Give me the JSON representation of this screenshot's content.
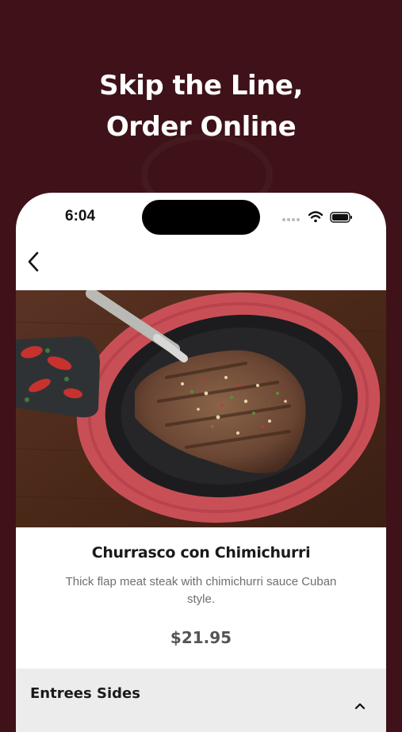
{
  "promo": {
    "headline_line1": "Skip the Line,",
    "headline_line2": "Order Online"
  },
  "status_bar": {
    "time": "6:04",
    "icons": [
      "cellular-signal-icon",
      "wifi-icon",
      "battery-icon"
    ]
  },
  "nav": {
    "back_icon": "chevron-left-icon"
  },
  "item": {
    "image": "steak-on-sizzling-plate",
    "name": "Churrasco con Chimichurri",
    "description": "Thick flap meat steak with chimichurri sauce Cuban style.",
    "price": "$21.95"
  },
  "sections": [
    {
      "title": "Entrees Sides",
      "expanded": true,
      "icon": "chevron-up-icon"
    }
  ],
  "colors": {
    "background": "#3e1218",
    "card": "#ffffff",
    "section_bar": "#ececec"
  }
}
